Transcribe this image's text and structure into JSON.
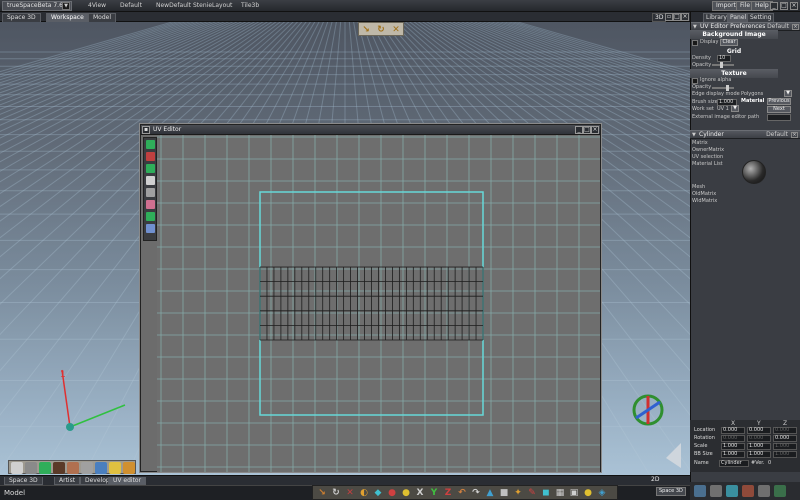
{
  "titlebar": {
    "app_name": "trueSpaceBeta 7.61",
    "layouts": [
      "4View",
      "Default",
      "NewDefault",
      "StenieLayout",
      "Tile3b"
    ],
    "menu": [
      "Import",
      "File",
      "Help"
    ]
  },
  "viewport": {
    "tabs": [
      "Space 3D",
      "Workspace",
      "Model"
    ],
    "active_tab": "Workspace",
    "mode_label": "3D"
  },
  "uv_editor": {
    "title": "UV Editor"
  },
  "right_panel": {
    "tabs": [
      "Library",
      "Panel",
      "Setting"
    ],
    "prefs": {
      "header": "UV Editor Preferences",
      "dropdown": "Default",
      "section_bg": "Background Image",
      "display_label": "Display",
      "clear_label": "Clear",
      "section_grid": "Grid",
      "density_label": "Density",
      "density_value": "10",
      "opacity_label": "Opacity",
      "section_texture": "Texture",
      "ignore_alpha_label": "Ignore alpha",
      "opacity2_label": "Opacity",
      "edge_mode_label": "Edge display mode",
      "edge_mode_value": "Polygons",
      "brush_size_label": "Brush size",
      "brush_size_value": "1.000",
      "material_label": "Material",
      "previous_label": "Previous",
      "work_set_label": "Work set",
      "work_set_value": "UV 1",
      "next_label": "Next",
      "ext_editor_label": "External image editor path"
    },
    "object": {
      "header": "Cylinder",
      "dropdown": "Default",
      "props": [
        "Matrix",
        "OwnerMatrix",
        "UV selection",
        "Material List"
      ],
      "props2": [
        "Mesh",
        "OldMatrix",
        "WldMatrix"
      ]
    },
    "transform": {
      "axes": [
        "X",
        "Y",
        "Z"
      ],
      "rows": [
        {
          "label": "Location",
          "values": [
            "0.000",
            "0.000",
            "0.000"
          ]
        },
        {
          "label": "Rotation",
          "values": [
            "0.000",
            "0.000",
            "0.000"
          ]
        },
        {
          "label": "Scale",
          "values": [
            "1.000",
            "1.000",
            "1.000"
          ]
        },
        {
          "label": "BB Size",
          "values": [
            "1.000",
            "1.000",
            "1.000"
          ]
        }
      ],
      "name_label": "Name",
      "name_value": "Cylinder",
      "ver_label": "#Ver.",
      "ver_value": "0"
    }
  },
  "bottom": {
    "tabs": [
      "Space 3D",
      "Artist",
      "Developer",
      "UV editor"
    ],
    "active_tab": "UV editor",
    "status": "Model",
    "mode_label": "2D",
    "space_label": "Space 3D"
  }
}
